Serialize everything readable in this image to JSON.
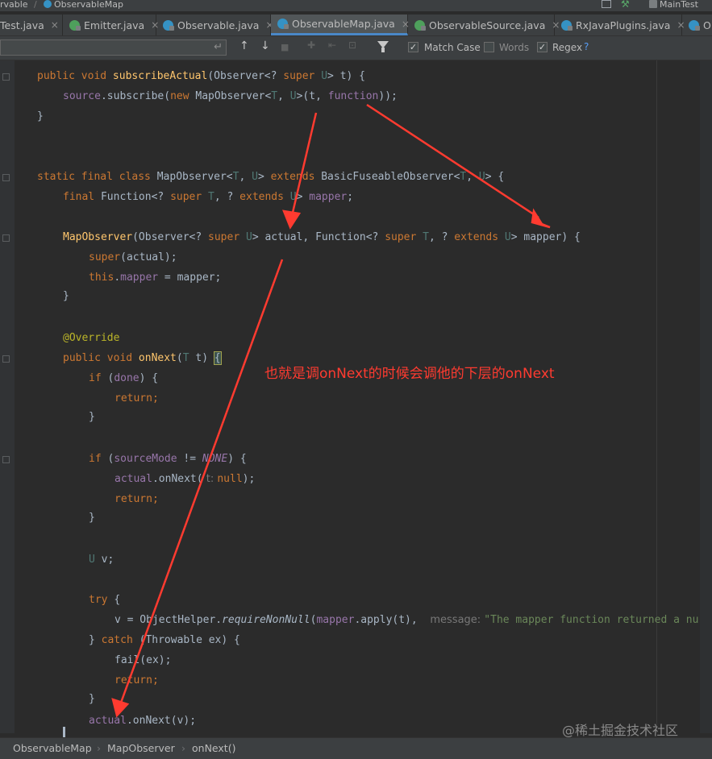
{
  "navbar": {
    "crumb1": "rvable",
    "sep": "/",
    "crumb2": "ObservableMap",
    "run_config": "MainTest"
  },
  "tabs": [
    {
      "label": "Test.java",
      "icon": "java-class-icon",
      "close": "×"
    },
    {
      "label": "Emitter.java",
      "icon": "java-interface-icon",
      "close": "×"
    },
    {
      "label": "Observable.java",
      "icon": "java-class-icon",
      "close": "×"
    },
    {
      "label": "ObservableMap.java",
      "icon": "java-class-icon",
      "close": "×",
      "active": true
    },
    {
      "label": "ObservableSource.java",
      "icon": "java-interface-icon",
      "close": "×"
    },
    {
      "label": "RxJavaPlugins.java",
      "icon": "java-class-icon",
      "close": "×"
    },
    {
      "label": "O",
      "icon": "java-class-icon"
    }
  ],
  "search": {
    "enter_glyph": "↵",
    "buttons": {
      "up": "↑",
      "down": "↓"
    },
    "match_case": {
      "label": "Match Case",
      "checked": true
    },
    "words": {
      "label": "Words",
      "checked": false
    },
    "regex": {
      "label": "Regex",
      "checked": true
    },
    "help": "?",
    "check_glyph": "✓"
  },
  "code": {
    "l1": {
      "a": "public void ",
      "b": "subscribeActual",
      "c": "(Observer<? ",
      "d": "super ",
      "e": "U",
      "f": "> t) {"
    },
    "l2": {
      "a": "source",
      "b": ".subscribe(",
      "c": "new ",
      "d": "MapObserver<",
      "e": "T",
      "f": ", ",
      "g": "U",
      "h": ">(t, ",
      "i": "function",
      "j": "));"
    },
    "l3": "}",
    "l4": {
      "a": "static final class ",
      "b": "MapObserver<",
      "c": "T",
      "d": ", ",
      "e": "U",
      "f": "> ",
      "g": "extends ",
      "h": "BasicFuseableObserver<",
      "i": "T",
      "j": ", ",
      "k": "U",
      "l": "> {"
    },
    "l5": {
      "a": "final ",
      "b": "Function<? ",
      "c": "super ",
      "d": "T",
      "e": ", ? ",
      "f": "extends ",
      "g": "U",
      "h": "> ",
      "i": "mapper",
      "j": ";"
    },
    "l6": {
      "a": "MapObserver",
      "b": "(Observer<? ",
      "c": "super ",
      "d": "U",
      "e": "> actual, Function<? ",
      "f": "super ",
      "g": "T",
      "h": ", ? ",
      "i": "extends ",
      "j": "U",
      "k": "> mapper) {"
    },
    "l7": {
      "a": "super",
      "b": "(actual);"
    },
    "l8": {
      "a": "this",
      "b": ".",
      "c": "mapper",
      "d": " = mapper;"
    },
    "l9": "}",
    "l10": "@Override",
    "l11": {
      "a": "public void ",
      "b": "onNext",
      "c": "(",
      "d": "T",
      "e": " t) ",
      "f": "{"
    },
    "l12": {
      "a": "if ",
      "b": "(",
      "c": "done",
      "d": ") {"
    },
    "l13": {
      "a": "return",
      "b": ";"
    },
    "l14": "}",
    "l15": {
      "a": "if ",
      "b": "(",
      "c": "sourceMode",
      "d": " != ",
      "e": "NONE",
      "f": ") {"
    },
    "l16": {
      "a": "actual",
      "b": ".onNext(",
      "c": " t: ",
      "d": "null",
      "e": ");"
    },
    "l17": {
      "a": "return",
      "b": ";"
    },
    "l18": "}",
    "l19": {
      "a": "U",
      "b": " v;"
    },
    "l20": {
      "a": "try ",
      "b": "{"
    },
    "l21": {
      "a": "v = ObjectHelper.",
      "b": "requireNonNull",
      "c": "(",
      "d": "mapper",
      "e": ".apply(t),  ",
      "f": "message: ",
      "g": "\"The mapper function returned a nu"
    },
    "l22": {
      "a": "} ",
      "b": "catch ",
      "c": "(Throwable ex) {"
    },
    "l23": "fail(ex);",
    "l24": {
      "a": "return",
      "b": ";"
    },
    "l25": "}",
    "l26": {
      "a": "actual",
      "b": ".onNext(v);"
    }
  },
  "annotation": {
    "text": "也就是调onNext的时候会调他的下层的onNext",
    "color": "#ff3b30"
  },
  "watermark": "@稀土掘金技术社区",
  "breadcrumb": {
    "item1": "ObservableMap",
    "item2": "MapObserver",
    "item3": "onNext()",
    "sep": "›"
  },
  "colors": {
    "keyword": "#cc7832",
    "method": "#ffc66d",
    "field": "#9876aa",
    "generic": "#507874",
    "annotation": "#bbb529",
    "arrow": "#ff3b30",
    "accent": "#4a88c7"
  }
}
